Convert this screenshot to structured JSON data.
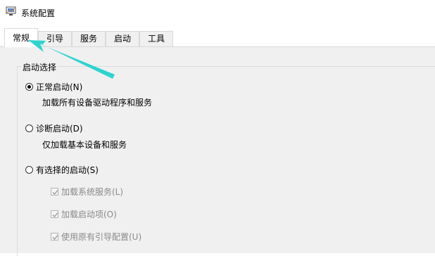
{
  "window": {
    "title": "系统配置",
    "icon": "system-config-icon"
  },
  "tabs": [
    {
      "label": "常规",
      "active": true
    },
    {
      "label": "引导",
      "active": false
    },
    {
      "label": "服务",
      "active": false
    },
    {
      "label": "启动",
      "active": false
    },
    {
      "label": "工具",
      "active": false
    }
  ],
  "startup_group": {
    "title": "启动选择",
    "options": [
      {
        "label": "正常启动(N)",
        "description": "加载所有设备驱动程序和服务",
        "selected": true
      },
      {
        "label": "诊断启动(D)",
        "description": "仅加载基本设备和服务",
        "selected": false
      },
      {
        "label": "有选择的启动(S)",
        "selected": false
      }
    ],
    "selective_items": [
      {
        "label": "加载系统服务(L)",
        "checked": true,
        "disabled": true
      },
      {
        "label": "加载启动项(O)",
        "checked": true,
        "disabled": true
      },
      {
        "label": "使用原有引导配置(U)",
        "checked": true,
        "disabled": true
      }
    ]
  },
  "annotation": {
    "arrow_color": "#2ED3CF",
    "icon": "pointer-arrow-icon"
  }
}
